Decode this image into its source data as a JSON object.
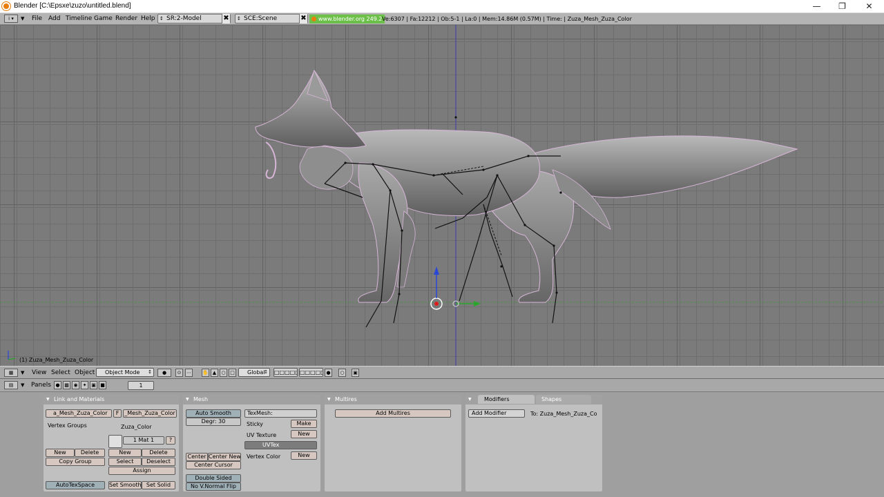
{
  "window": {
    "title": "Blender [C:\\Epsxe\\zuzo\\untitled.blend]",
    "min_icon": "minimize-icon",
    "max_icon": "restore-icon",
    "close_icon": "close-icon"
  },
  "info_header": {
    "menus": [
      "File",
      "Add",
      "Timeline",
      "Game",
      "Render",
      "Help"
    ],
    "screen": "SR:2-Model",
    "scene": "SCE:Scene",
    "url": "www.blender.org 249.2",
    "stats": "Ve:6307 | Fa:12212 | Ob:5-1 | La:0  | Mem:14.86M (0.57M) | Time: | Zuza_Mesh_Zuza_Color"
  },
  "viewport": {
    "object_label": "(1) Zuza_Mesh_Zuza_Color"
  },
  "view_header": {
    "menus": [
      "View",
      "Select",
      "Object"
    ],
    "mode": "Object Mode",
    "orientation": "Global"
  },
  "buttons_header": {
    "panels_label": "Panels",
    "frame": "1"
  },
  "link_materials": {
    "title": "Link and Materials",
    "mesh_name": "a_Mesh_Zuza_Color",
    "f_label": "F",
    "object_name": "_Mesh_Zuza_Color",
    "vertex_groups": "Vertex Groups",
    "material_name": "Zuza_Color",
    "mat_index": "1 Mat 1",
    "question": "?",
    "vg_new": "New",
    "vg_delete": "Delete",
    "copy_group": "Copy Group",
    "mat_new": "New",
    "mat_delete": "Delete",
    "select": "Select",
    "deselect": "Deselect",
    "assign": "Assign",
    "autotexspace": "AutoTexSpace",
    "set_smooth": "Set Smooth",
    "set_solid": "Set Solid"
  },
  "mesh": {
    "title": "Mesh",
    "auto_smooth": "Auto Smooth",
    "degr": "Degr: 30",
    "texmesh": "TexMesh:",
    "sticky": "Sticky",
    "make": "Make",
    "uv_texture": "UV Texture",
    "uv_new": "New",
    "uvtex": "UVTex",
    "vertex_color": "Vertex Color",
    "vc_new": "New",
    "center": "Center",
    "center_new": "Center New",
    "center_cursor": "Center Cursor",
    "double_sided": "Double Sided",
    "no_v_normal_flip": "No V.Normal Flip"
  },
  "multires": {
    "title": "Multires",
    "add": "Add Multires"
  },
  "modifiers": {
    "tab_modifiers": "Modifiers",
    "tab_shapes": "Shapes",
    "add": "Add Modifier",
    "to": "To: Zuza_Mesh_Zuza_Co"
  },
  "colors": {
    "viewport_bg": "#7b7b7b",
    "url_green": "#6cc04a",
    "blender_orange": "#e87d0d"
  }
}
